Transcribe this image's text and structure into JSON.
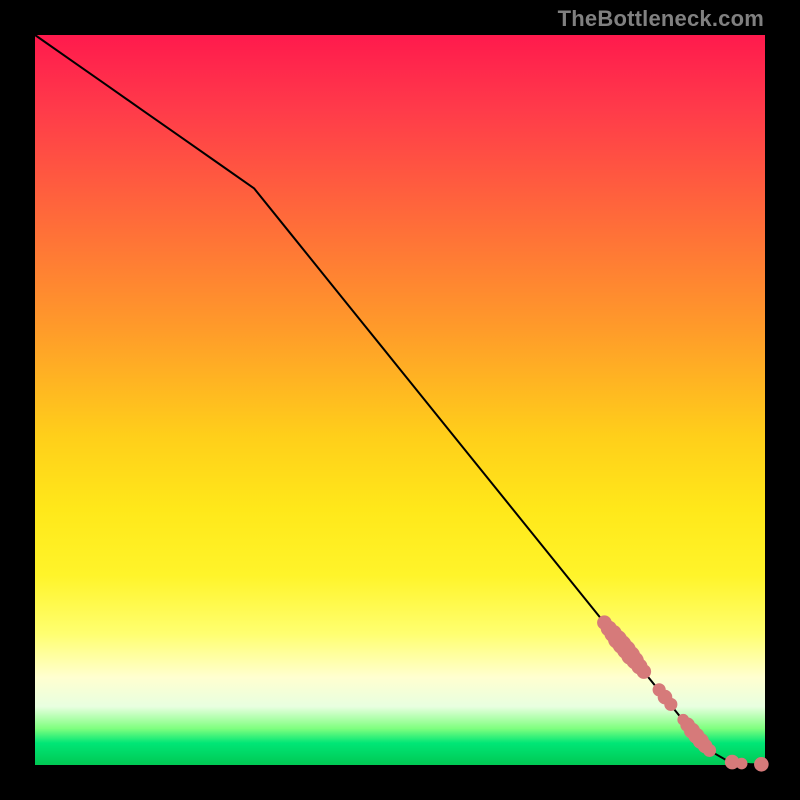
{
  "attribution": "TheBottleneck.com",
  "colors": {
    "dot": "#d67a7a",
    "curve": "#000000",
    "frame": "#000000"
  },
  "chart_data": {
    "type": "line",
    "title": "",
    "xlabel": "",
    "ylabel": "",
    "xlim": [
      0,
      100
    ],
    "ylim": [
      0,
      100
    ],
    "grid": false,
    "legend": false,
    "series": [
      {
        "name": "curve",
        "x": [
          0,
          5,
          10,
          15,
          20,
          25,
          30,
          35,
          40,
          45,
          50,
          55,
          60,
          65,
          70,
          75,
          80,
          85,
          90,
          92,
          95,
          98,
          100
        ],
        "y": [
          100,
          96.5,
          93,
          89.5,
          86,
          82.5,
          79,
          72.8,
          66.6,
          60.4,
          54.2,
          48.0,
          41.8,
          35.6,
          29.4,
          23.2,
          17.0,
          10.8,
          4.6,
          2.2,
          0.5,
          0.1,
          0.1
        ]
      }
    ],
    "scatter_clusters": [
      {
        "name": "cluster-upper",
        "points": [
          {
            "x": 78.0,
            "y": 19.5,
            "r": 1.0
          },
          {
            "x": 78.6,
            "y": 18.7,
            "r": 1.1
          },
          {
            "x": 79.2,
            "y": 18.0,
            "r": 1.2
          },
          {
            "x": 79.8,
            "y": 17.2,
            "r": 1.3
          },
          {
            "x": 80.4,
            "y": 16.5,
            "r": 1.3
          },
          {
            "x": 81.0,
            "y": 15.8,
            "r": 1.3
          },
          {
            "x": 81.6,
            "y": 15.0,
            "r": 1.3
          },
          {
            "x": 82.2,
            "y": 14.3,
            "r": 1.2
          },
          {
            "x": 82.8,
            "y": 13.5,
            "r": 1.1
          },
          {
            "x": 83.4,
            "y": 12.8,
            "r": 1.0
          }
        ]
      },
      {
        "name": "cluster-mid",
        "points": [
          {
            "x": 85.5,
            "y": 10.3,
            "r": 0.9
          },
          {
            "x": 86.3,
            "y": 9.3,
            "r": 1.0
          },
          {
            "x": 87.1,
            "y": 8.3,
            "r": 0.9
          }
        ]
      },
      {
        "name": "cluster-lower",
        "points": [
          {
            "x": 88.8,
            "y": 6.2,
            "r": 0.8
          },
          {
            "x": 89.4,
            "y": 5.5,
            "r": 1.0
          },
          {
            "x": 90.0,
            "y": 4.7,
            "r": 1.1
          },
          {
            "x": 90.6,
            "y": 4.0,
            "r": 1.1
          },
          {
            "x": 91.2,
            "y": 3.3,
            "r": 1.1
          },
          {
            "x": 91.8,
            "y": 2.6,
            "r": 1.0
          },
          {
            "x": 92.4,
            "y": 2.0,
            "r": 0.9
          }
        ]
      },
      {
        "name": "cluster-tail",
        "points": [
          {
            "x": 95.5,
            "y": 0.4,
            "r": 1.0
          },
          {
            "x": 96.8,
            "y": 0.2,
            "r": 0.8
          },
          {
            "x": 99.5,
            "y": 0.1,
            "r": 1.0
          }
        ]
      }
    ]
  }
}
